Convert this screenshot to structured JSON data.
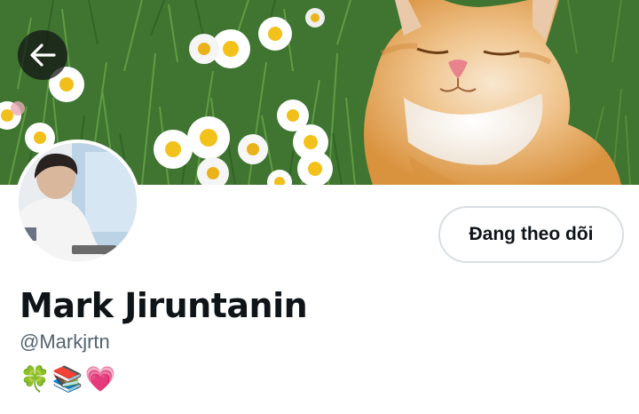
{
  "header": {
    "back_icon": "arrow-left-icon",
    "banner_image": "cat-in-daisy-field-photo"
  },
  "profile": {
    "avatar": "user-avatar-photo",
    "follow_button_label": "Đang theo dõi",
    "display_name": "Mark Jiruntanin",
    "handle": "@Markjrtn",
    "bio": "🍀📚💗"
  },
  "colors": {
    "text_primary": "#0f1419",
    "text_secondary": "#536471",
    "button_border": "#d8dee3"
  }
}
